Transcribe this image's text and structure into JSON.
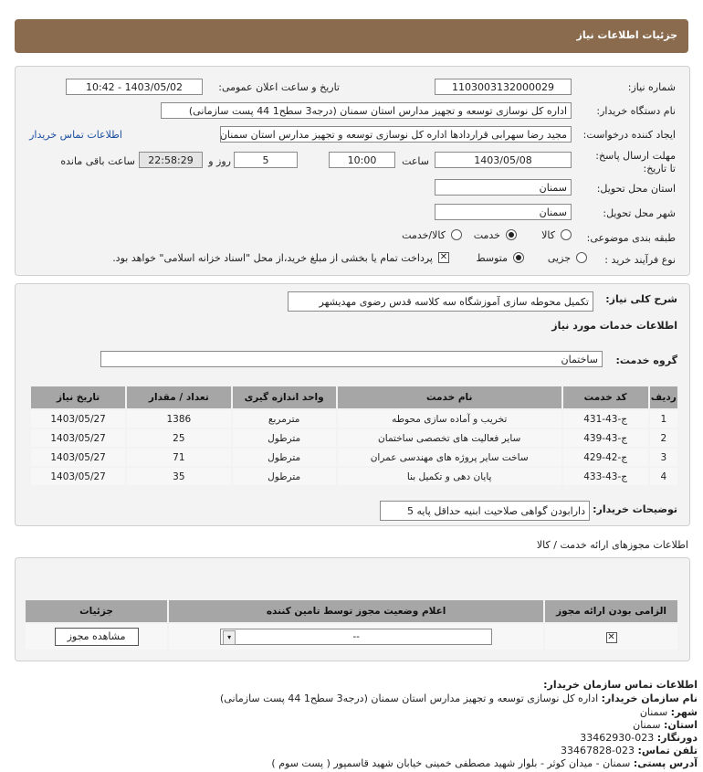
{
  "header": {
    "title": "جزئیات اطلاعات نیاز"
  },
  "form": {
    "need_number_label": "شماره نیاز:",
    "need_number": "1103003132000029",
    "announce_label": "تاریخ و ساعت اعلان عمومی:",
    "announce_value": "1403/05/02 - 10:42",
    "buyer_org_label": "نام دستگاه خریدار:",
    "buyer_org": "اداره کل نوسازی   توسعه و تجهیز مدارس استان سمنان (درجه3  سطح1  44 پست سازمانی)",
    "creator_label": "ایجاد کننده درخواست:",
    "creator": "مجید رضا سهرابی قراردادها اداره کل نوسازی   توسعه و تجهیز مدارس استان سمنان",
    "contact_link": "اطلاعات تماس خریدار",
    "deadline_label": "مهلت ارسال پاسخ: تا تاریخ:",
    "deadline_date": "1403/05/08",
    "time_label": "ساعت",
    "deadline_time": "10:00",
    "days": "5",
    "days_label": "روز و",
    "remaining": "22:58:29",
    "remaining_label": "ساعت باقی مانده",
    "delivery_province_label": "استان محل تحویل:",
    "delivery_province": "سمنان",
    "delivery_city_label": "شهر محل تحویل:",
    "delivery_city": "سمنان",
    "category_label": "طبقه بندی موضوعی:",
    "category_options": [
      "کالا",
      "خدمت",
      "کالا/خدمت"
    ],
    "category_selected": "خدمت",
    "process_label": "نوع فرآیند خرید :",
    "process_options": [
      "جزیی",
      "متوسط"
    ],
    "process_selected": "متوسط",
    "payment_note": "پرداخت تمام یا بخشی از مبلغ خرید،از محل \"اسناد خزانه اسلامی\" خواهد بود."
  },
  "description": {
    "label": "شرح کلی نیاز:",
    "value": "تکمیل محوطه سازی آموزشگاه سه کلاسه قدس رضوی مهدیشهر"
  },
  "services": {
    "section_title": "اطلاعات خدمات مورد نیاز",
    "group_label": "گروه خدمت:",
    "group_value": "ساختمان",
    "columns": [
      "ردیف",
      "کد خدمت",
      "نام خدمت",
      "واحد اندازه گیری",
      "تعداد / مقدار",
      "تاریخ نیاز"
    ],
    "rows": [
      [
        "1",
        "ج-43-431",
        "تخریب و آماده سازی محوطه",
        "مترمربع",
        "1386",
        "1403/05/27"
      ],
      [
        "2",
        "ج-43-439",
        "سایر فعالیت های تخصصی ساختمان",
        "مترطول",
        "25",
        "1403/05/27"
      ],
      [
        "3",
        "ج-42-429",
        "ساخت سایر پروژه های مهندسی عمران",
        "مترطول",
        "71",
        "1403/05/27"
      ],
      [
        "4",
        "ج-43-433",
        "پایان دهی و تکمیل بنا",
        "مترطول",
        "35",
        "1403/05/27"
      ]
    ]
  },
  "buyer_notes": {
    "label": "توضیحات خریدار:",
    "value": "دارابودن گواهی صلاحیت ابنیه حداقل پایه 5"
  },
  "permits": {
    "title": "اطلاعات مجوزهای ارائه خدمت / کالا",
    "columns": [
      "الزامی بودن ارائه مجوز",
      "اعلام وضعیت مجوز توسط تامین کننده",
      "جزئیات"
    ],
    "select_value": "--",
    "view_button": "مشاهده مجوز"
  },
  "contact": {
    "title": "اطلاعات تماس سازمان خریدار:",
    "org_label": "نام سازمان خریدار:",
    "org_value": "اداره کل نوسازی توسعه و تجهیز مدارس استان سمنان (درجه3 سطح1 44 پست سازمانی)",
    "city_label": "شهر:",
    "city_value": "سمنان",
    "province_label": "استان:",
    "province_value": "سمنان",
    "fax_label": "دورنگار:",
    "fax_value": "023-33462930",
    "phone_label": "تلفن تماس:",
    "phone_value": "023-33467828",
    "address_label": "آدرس پستی:",
    "address_value": "سمنان - میدان کوثر - بلوار شهید مصطفی خمینی خیابان شهید قاسمپور ( پست سوم )"
  }
}
